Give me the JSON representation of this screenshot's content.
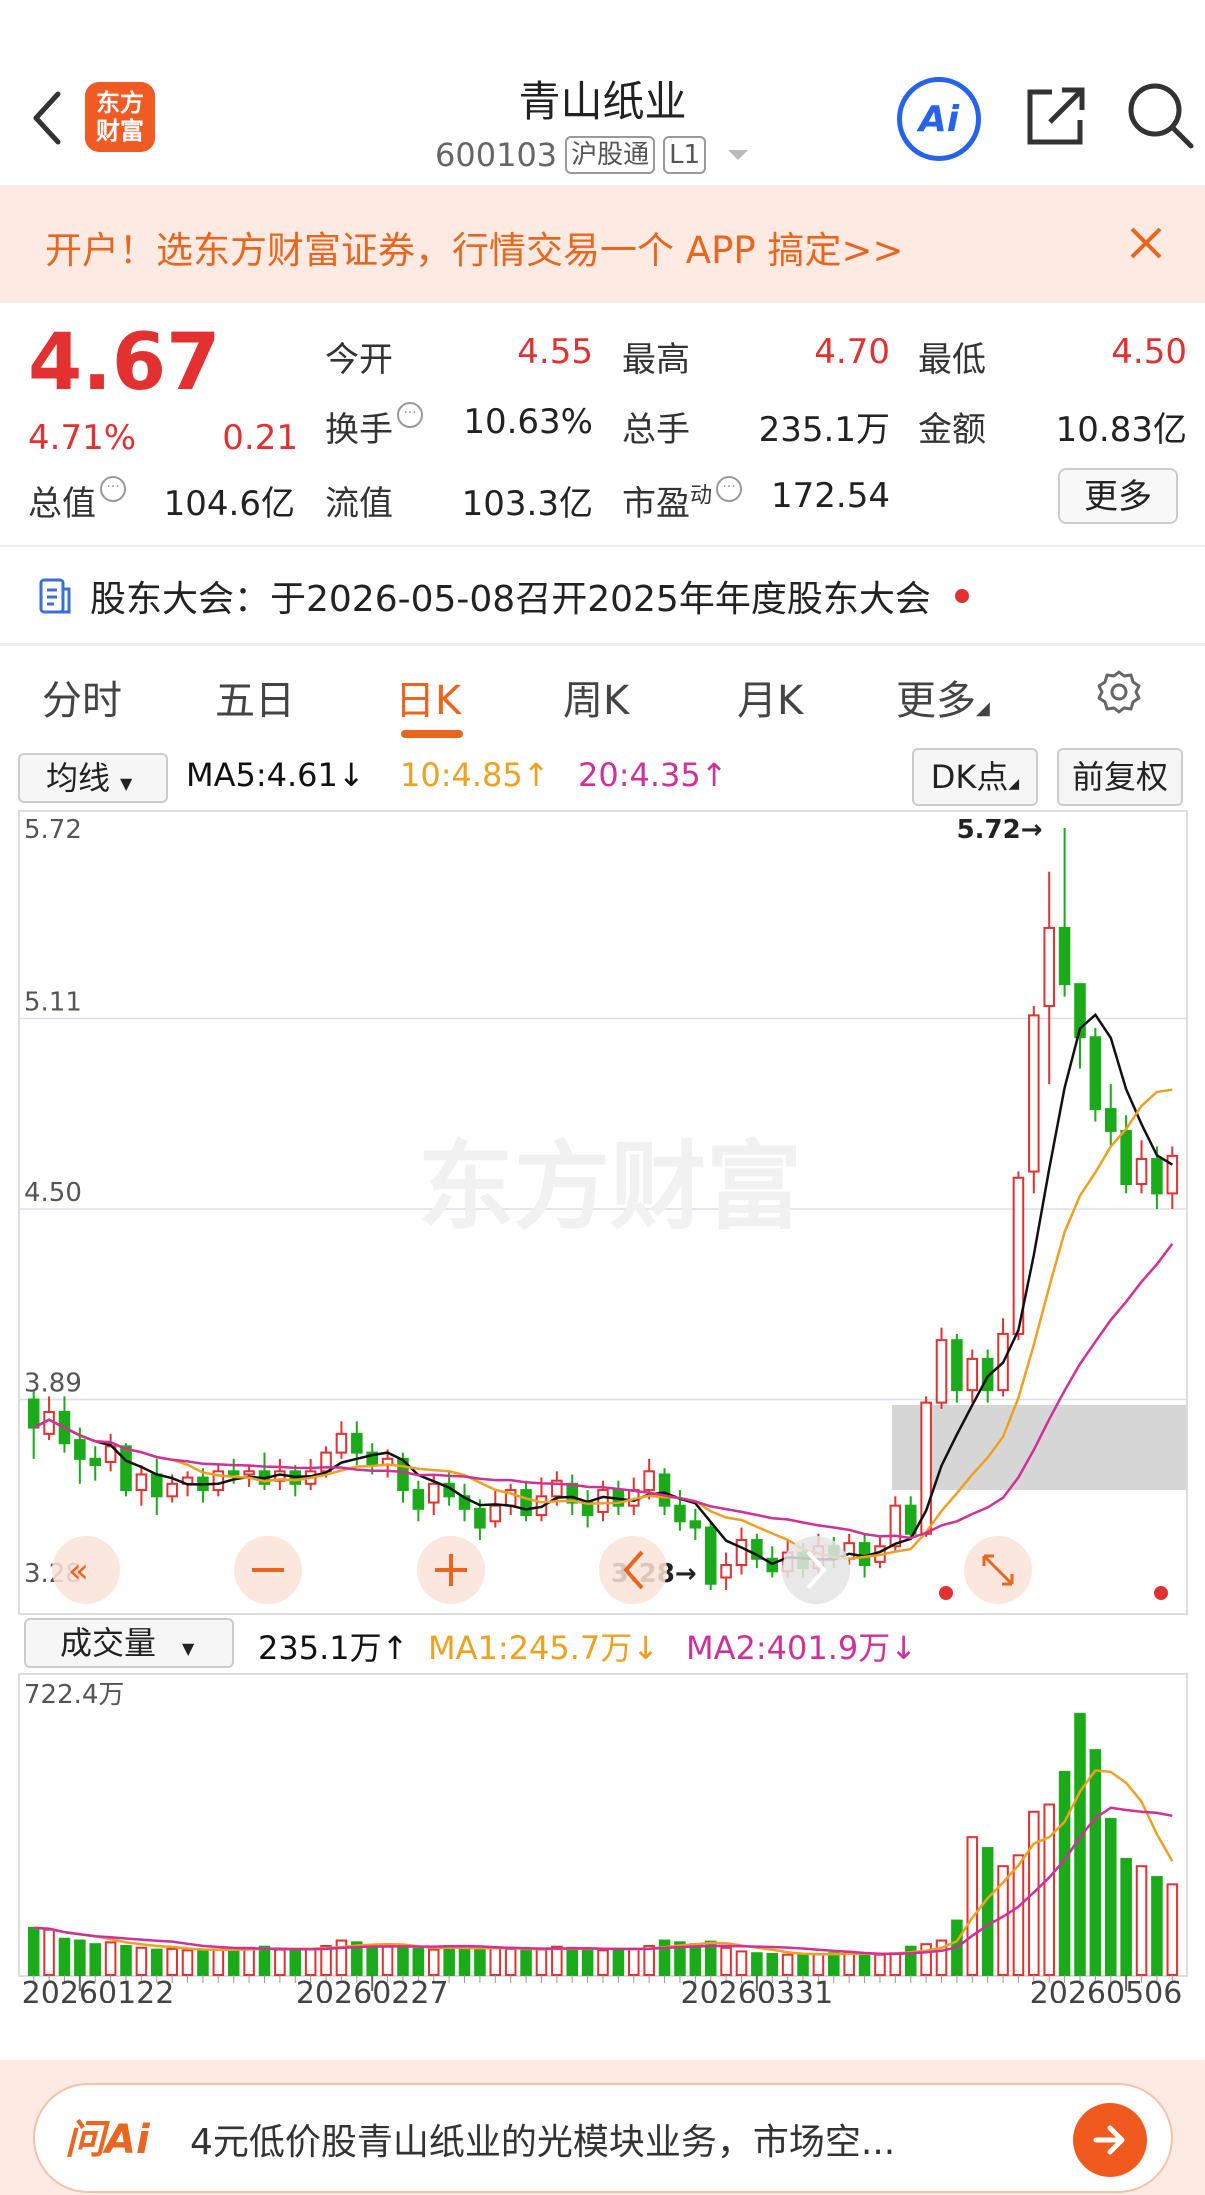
{
  "header": {
    "title": "青山纸业",
    "code": "600103",
    "market_tag": "沪股通",
    "level_tag": "L1",
    "logo_text_1": "东方",
    "logo_text_2": "财富",
    "ai_label": "Ai"
  },
  "banner": {
    "text": "开户！选东方财富证券，行情交易一个 APP 搞定>>"
  },
  "quote": {
    "price": "4.67",
    "change_pct": "4.71%",
    "change": "0.21",
    "open_label": "今开",
    "open": "4.55",
    "high_label": "最高",
    "high": "4.70",
    "low_label": "最低",
    "low": "4.50",
    "turnover_label": "换手",
    "turnover": "10.63%",
    "volume_label": "总手",
    "volume": "235.1万",
    "amount_label": "金额",
    "amount": "10.83亿",
    "mktcap_label": "总值",
    "mktcap": "104.6亿",
    "float_label": "流值",
    "float": "103.3亿",
    "pe_label": "市盈",
    "pe_sup": "动",
    "pe": "172.54",
    "more_label": "更多"
  },
  "notice": {
    "text": "股东大会：于2026-05-08召开2025年年度股东大会"
  },
  "tabs": [
    "分时",
    "五日",
    "日K",
    "周K",
    "月K",
    "更多"
  ],
  "active_tab": "日K",
  "chart_toolbar": {
    "indicator": "均线",
    "ma5": "MA5:4.61↓",
    "ma10": "10:4.85↑",
    "ma20": "20:4.35↑",
    "dk": "DK点",
    "adjust": "前复权"
  },
  "volume_toolbar": {
    "indicator": "成交量",
    "vol": "235.1万↑",
    "ma1": "MA1:245.7万↓",
    "ma2": "MA2:401.9万↓"
  },
  "colors": {
    "up": "#e33030",
    "down": "#1aaa1a",
    "ma5": "#111111",
    "ma10": "#f0a020",
    "ma20": "#d0309a",
    "accent": "#e8661f"
  },
  "chart_data": {
    "type": "candlestick",
    "y_labels": [
      "5.72",
      "5.11",
      "4.50",
      "3.89",
      "3.28"
    ],
    "ylim": [
      3.28,
      5.72
    ],
    "max_label": "5.72→",
    "min_label": "3.28→",
    "x_labels": [
      "20260122",
      "20260227",
      "20260331",
      "20260506"
    ],
    "candles": [
      [
        3.89,
        3.8,
        3.92,
        3.7
      ],
      [
        3.78,
        3.85,
        3.9,
        3.76
      ],
      [
        3.85,
        3.75,
        3.9,
        3.72
      ],
      [
        3.76,
        3.7,
        3.8,
        3.62
      ],
      [
        3.7,
        3.68,
        3.74,
        3.63
      ],
      [
        3.69,
        3.74,
        3.78,
        3.66
      ],
      [
        3.74,
        3.6,
        3.75,
        3.58
      ],
      [
        3.6,
        3.65,
        3.68,
        3.55
      ],
      [
        3.65,
        3.58,
        3.7,
        3.52
      ],
      [
        3.58,
        3.62,
        3.65,
        3.56
      ],
      [
        3.62,
        3.64,
        3.66,
        3.58
      ],
      [
        3.64,
        3.6,
        3.67,
        3.56
      ],
      [
        3.6,
        3.66,
        3.68,
        3.58
      ],
      [
        3.66,
        3.65,
        3.7,
        3.62
      ],
      [
        3.65,
        3.66,
        3.68,
        3.61
      ],
      [
        3.66,
        3.62,
        3.72,
        3.6
      ],
      [
        3.63,
        3.66,
        3.7,
        3.6
      ],
      [
        3.66,
        3.62,
        3.68,
        3.58
      ],
      [
        3.62,
        3.66,
        3.7,
        3.6
      ],
      [
        3.66,
        3.72,
        3.74,
        3.64
      ],
      [
        3.72,
        3.78,
        3.82,
        3.7
      ],
      [
        3.78,
        3.72,
        3.82,
        3.68
      ],
      [
        3.72,
        3.68,
        3.75,
        3.65
      ],
      [
        3.68,
        3.7,
        3.73,
        3.64
      ],
      [
        3.7,
        3.6,
        3.72,
        3.56
      ],
      [
        3.6,
        3.54,
        3.63,
        3.5
      ],
      [
        3.56,
        3.62,
        3.65,
        3.52
      ],
      [
        3.62,
        3.58,
        3.66,
        3.55
      ],
      [
        3.58,
        3.54,
        3.62,
        3.5
      ],
      [
        3.54,
        3.48,
        3.57,
        3.44
      ],
      [
        3.5,
        3.55,
        3.6,
        3.48
      ],
      [
        3.55,
        3.6,
        3.62,
        3.52
      ],
      [
        3.6,
        3.52,
        3.63,
        3.5
      ],
      [
        3.52,
        3.58,
        3.64,
        3.5
      ],
      [
        3.58,
        3.63,
        3.66,
        3.55
      ],
      [
        3.62,
        3.56,
        3.65,
        3.52
      ],
      [
        3.56,
        3.52,
        3.6,
        3.48
      ],
      [
        3.53,
        3.6,
        3.63,
        3.5
      ],
      [
        3.6,
        3.55,
        3.63,
        3.52
      ],
      [
        3.55,
        3.6,
        3.64,
        3.52
      ],
      [
        3.6,
        3.66,
        3.7,
        3.57
      ],
      [
        3.65,
        3.55,
        3.67,
        3.52
      ],
      [
        3.55,
        3.5,
        3.6,
        3.47
      ],
      [
        3.5,
        3.48,
        3.54,
        3.44
      ],
      [
        3.48,
        3.3,
        3.5,
        3.28
      ],
      [
        3.32,
        3.36,
        3.4,
        3.28
      ],
      [
        3.36,
        3.44,
        3.48,
        3.33
      ],
      [
        3.44,
        3.38,
        3.46,
        3.35
      ],
      [
        3.38,
        3.34,
        3.42,
        3.32
      ],
      [
        3.34,
        3.4,
        3.44,
        3.32
      ],
      [
        3.4,
        3.35,
        3.43,
        3.32
      ],
      [
        3.35,
        3.42,
        3.46,
        3.33
      ],
      [
        3.42,
        3.38,
        3.45,
        3.35
      ],
      [
        3.38,
        3.43,
        3.46,
        3.36
      ],
      [
        3.43,
        3.36,
        3.46,
        3.32
      ],
      [
        3.37,
        3.42,
        3.45,
        3.35
      ],
      [
        3.42,
        3.55,
        3.58,
        3.4
      ],
      [
        3.55,
        3.46,
        3.58,
        3.44
      ],
      [
        3.46,
        3.88,
        3.9,
        3.45
      ],
      [
        3.88,
        4.08,
        4.12,
        3.86
      ],
      [
        4.08,
        3.92,
        4.1,
        3.88
      ],
      [
        3.92,
        4.02,
        4.05,
        3.88
      ],
      [
        4.02,
        3.92,
        4.05,
        3.88
      ],
      [
        3.92,
        4.1,
        4.15,
        3.9
      ],
      [
        4.1,
        4.6,
        4.62,
        4.08
      ],
      [
        4.62,
        5.12,
        5.15,
        4.55
      ],
      [
        5.15,
        5.4,
        5.58,
        4.9
      ],
      [
        5.4,
        5.22,
        5.72,
        5.18
      ],
      [
        5.22,
        5.05,
        5.15,
        4.95
      ],
      [
        5.05,
        4.82,
        5.08,
        4.78
      ],
      [
        4.82,
        4.75,
        4.9,
        4.7
      ],
      [
        4.75,
        4.58,
        4.8,
        4.55
      ],
      [
        4.58,
        4.66,
        4.72,
        4.55
      ],
      [
        4.66,
        4.55,
        4.7,
        4.5
      ],
      [
        4.55,
        4.67,
        4.7,
        4.5
      ]
    ],
    "volume_label": "722.4万",
    "volume_max": 722.4,
    "volumes": [
      130,
      125,
      100,
      95,
      85,
      90,
      80,
      75,
      70,
      72,
      68,
      66,
      70,
      72,
      75,
      78,
      70,
      68,
      72,
      80,
      95,
      90,
      82,
      78,
      75,
      72,
      70,
      80,
      76,
      70,
      74,
      72,
      68,
      70,
      78,
      75,
      72,
      68,
      70,
      72,
      80,
      95,
      90,
      85,
      92,
      75,
      65,
      60,
      58,
      56,
      55,
      58,
      60,
      62,
      58,
      56,
      60,
      78,
      85,
      95,
      150,
      380,
      350,
      300,
      330,
      450,
      470,
      560,
      720,
      620,
      430,
      320,
      300,
      270,
      250
    ]
  },
  "bottom_bar": {
    "ai_label": "问Ai",
    "text": "4元低价股青山纸业的光模块业务，市场空..."
  }
}
